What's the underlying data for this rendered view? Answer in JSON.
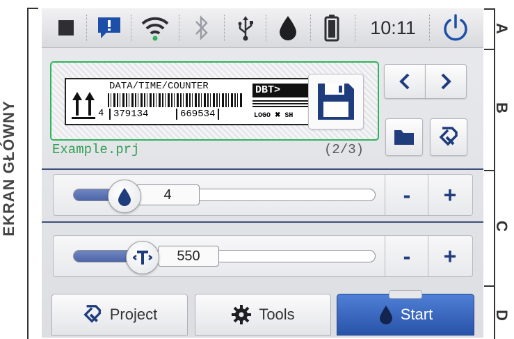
{
  "annotations": {
    "screen_title": "EKRAN GŁÓWNY",
    "sections": [
      "A",
      "B",
      "C",
      "D"
    ]
  },
  "status_bar": {
    "icons": [
      "stop-square-icon",
      "alert-message-icon",
      "wifi-icon",
      "bluetooth-icon",
      "usb-icon",
      "ink-drop-icon",
      "battery-icon",
      "power-icon"
    ],
    "time": "10:11",
    "colors": {
      "alert": "#1e4fa8",
      "wifi_dot": "#2fb45a",
      "power": "#1e4fa8"
    }
  },
  "project": {
    "label_header": "DATA/TIME/COUNTER",
    "arrow_subscript": "4",
    "barcode_number_1": "379134",
    "barcode_number_2": "669534",
    "dbt_text": "DBT>",
    "logo_text": "LOGO ✖ SH",
    "name": "Example.prj",
    "counter": "(2/3)",
    "accent": "#2fb45a"
  },
  "sliders": [
    {
      "name": "ink",
      "value": "4",
      "fill": 0.22,
      "icon": "ink-drop-icon"
    },
    {
      "name": "temperature",
      "value": "550",
      "fill": 0.3,
      "icon": "temperature-icon"
    }
  ],
  "controls": {
    "minus": "-",
    "plus": "+"
  },
  "tabs": [
    {
      "label": "Project",
      "icon": "project-icon",
      "active": false
    },
    {
      "label": "Tools",
      "icon": "gear-icon",
      "active": false
    },
    {
      "label": "Start",
      "icon": "ink-drop-icon",
      "active": true
    }
  ],
  "brand_color": "#1f3c7c"
}
